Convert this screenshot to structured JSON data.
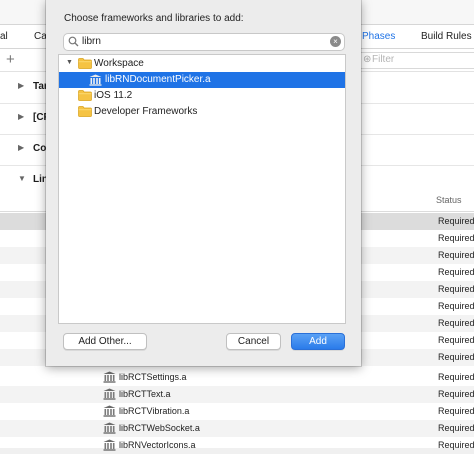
{
  "background": {
    "tabs": [
      {
        "label": "al"
      },
      {
        "label": "Ca"
      },
      {
        "label": "Phases",
        "active": true
      },
      {
        "label": "Build Rules"
      }
    ],
    "add_label": "+",
    "filter_placeholder": "Filter",
    "sections": [
      {
        "label": "Tar"
      },
      {
        "label": "[CP"
      },
      {
        "label": "Co"
      },
      {
        "label": "Lin"
      }
    ],
    "status_header": "Status",
    "status_value": "Required",
    "files": [
      "libRCTSettings.a",
      "libRCTText.a",
      "libRCTVibration.a",
      "libRCTWebSocket.a",
      "libRNVectorIcons.a"
    ]
  },
  "dialog": {
    "title": "Choose frameworks and libraries to add:",
    "search_value": "librn",
    "items": [
      {
        "label": "Workspace",
        "type": "folder",
        "expanded": true
      },
      {
        "label": "libRNDocumentPicker.a",
        "type": "library",
        "selected": true
      },
      {
        "label": "iOS 11.2",
        "type": "folder"
      },
      {
        "label": "Developer Frameworks",
        "type": "folder"
      }
    ],
    "add_other_label": "Add Other...",
    "cancel_label": "Cancel",
    "add_label": "Add"
  },
  "colors": {
    "accent": "#1f73e6",
    "folder": "#f5c343"
  }
}
